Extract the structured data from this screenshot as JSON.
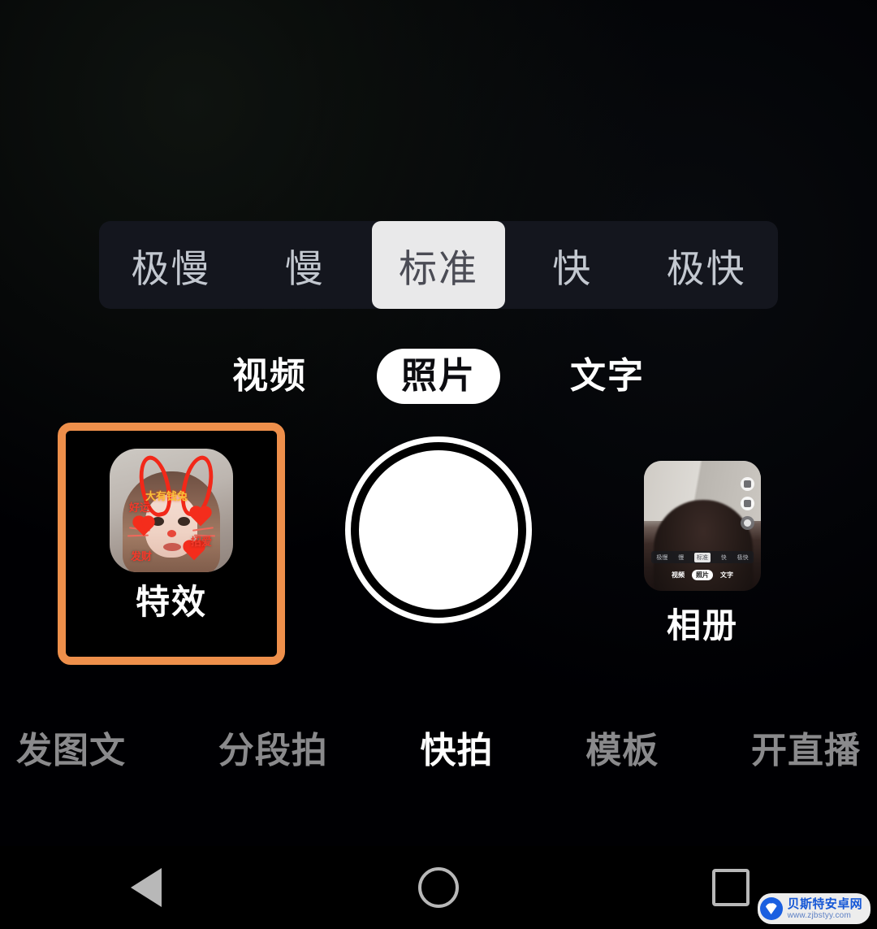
{
  "app": {
    "screen_name": "相机拍摄界面",
    "background_color": "#000000",
    "accent_color": "#ee8f4b"
  },
  "speed_bar": {
    "selected": "标准",
    "items": [
      {
        "label": "极慢",
        "selected": false
      },
      {
        "label": "慢",
        "selected": false
      },
      {
        "label": "标准",
        "selected": true
      },
      {
        "label": "快",
        "selected": false
      },
      {
        "label": "极快",
        "selected": false
      }
    ],
    "background_color": "#14161e",
    "selected_background": "#e9e9ea",
    "selected_text_color": "#4b4c55",
    "text_color": "#c3c8d0"
  },
  "mode_tabs": {
    "selected": "照片",
    "items": [
      {
        "label": "视频",
        "selected": false
      },
      {
        "label": "照片",
        "selected": true
      },
      {
        "label": "文字",
        "selected": false
      }
    ]
  },
  "capture": {
    "effects": {
      "label": "特效",
      "highlighted": true,
      "highlight_color": "#ee8f4b",
      "thumbnail": {
        "description": "贴纸特效预览：红色兔耳朵、爱心、猫须与金色文字",
        "stickers": [
          {
            "text": "大有钱兔",
            "color": "#f8c23a"
          },
          {
            "text": "好运",
            "color": "#f4392a"
          },
          {
            "text": "发财",
            "color": "#f4392a"
          },
          {
            "text": "招爱",
            "color": "#f4392a"
          }
        ]
      }
    },
    "shutter": {
      "label": "拍摄按钮",
      "ring_color": "#ffffff",
      "core_color": "#ffffff"
    },
    "gallery": {
      "label": "相册",
      "thumbnail": {
        "description": "最近照片：同款拍摄界面截图",
        "mini_speed": [
          {
            "label": "极慢",
            "selected": false
          },
          {
            "label": "慢",
            "selected": false
          },
          {
            "label": "标准",
            "selected": true
          },
          {
            "label": "快",
            "selected": false
          },
          {
            "label": "极快",
            "selected": false
          }
        ],
        "mini_modes": [
          {
            "label": "视频",
            "selected": false
          },
          {
            "label": "照片",
            "selected": true
          },
          {
            "label": "文字",
            "selected": false
          }
        ]
      }
    }
  },
  "bottom_nav": {
    "selected": "快拍",
    "items": [
      {
        "label": "发图文",
        "selected": false
      },
      {
        "label": "分段拍",
        "selected": false
      },
      {
        "label": "快拍",
        "selected": true
      },
      {
        "label": "模板",
        "selected": false
      },
      {
        "label": "开直播",
        "selected": false
      }
    ]
  },
  "system_nav": {
    "items": [
      {
        "name": "back",
        "glyph": "triangle-left-icon"
      },
      {
        "name": "home",
        "glyph": "circle-icon"
      },
      {
        "name": "recents",
        "glyph": "square-icon"
      }
    ]
  },
  "watermark": {
    "title": "贝斯特安卓网",
    "url": "www.zjbstyy.com",
    "brand_color": "#1557d6"
  }
}
